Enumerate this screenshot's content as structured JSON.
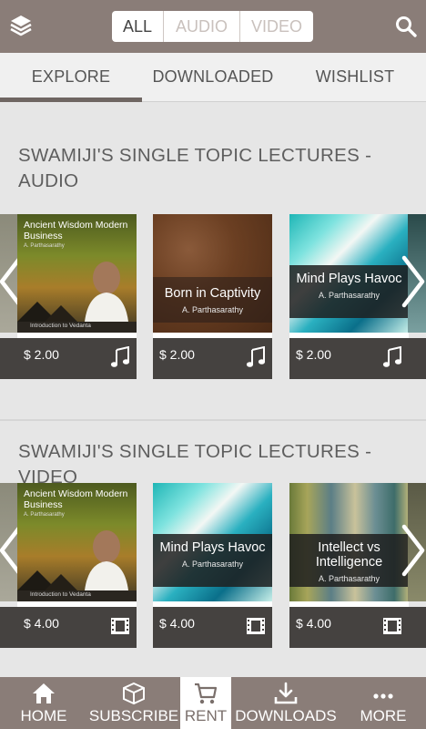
{
  "header": {
    "segments": [
      "ALL",
      "AUDIO",
      "VIDEO"
    ]
  },
  "tabs": [
    "EXPLORE",
    "DOWNLOADED",
    "WISHLIST"
  ],
  "sections": [
    {
      "title": "SWAMIJI'S SINGLE TOPIC LECTURES - AUDIO",
      "items": [
        {
          "title": "Ancient Wisdom Modern Business",
          "author": "A. Parthasarathy",
          "subtitle": "Introduction to Vedanta",
          "price": "$ 2.00",
          "icon": "music-note-icon"
        },
        {
          "title": "Born in Captivity",
          "author": "A. Parthasarathy",
          "price": "$ 2.00",
          "icon": "music-note-icon"
        },
        {
          "title": "Mind Plays Havoc",
          "author": "A. Parthasarathy",
          "price": "$ 2.00",
          "icon": "music-note-icon"
        }
      ]
    },
    {
      "title": "SWAMIJI'S SINGLE TOPIC LECTURES - VIDEO",
      "items": [
        {
          "title": "Ancient Wisdom Modern Business",
          "author": "A. Parthasarathy",
          "subtitle": "Introduction to Vedanta",
          "price": "$ 4.00",
          "icon": "film-icon"
        },
        {
          "title": "Mind Plays Havoc",
          "author": "A. Parthasarathy",
          "price": "$ 4.00",
          "icon": "film-icon"
        },
        {
          "title": "Intellect vs Intelligence",
          "author": "A. Parthasarathy",
          "price": "$ 4.00",
          "icon": "film-icon"
        }
      ]
    }
  ],
  "bottom_nav": [
    "HOME",
    "SUBSCRIBE",
    "RENT",
    "DOWNLOADS",
    "MORE"
  ],
  "colors": {
    "bar": "#8a7d78",
    "price_bar": "#454240",
    "accent": "#6f6662"
  }
}
